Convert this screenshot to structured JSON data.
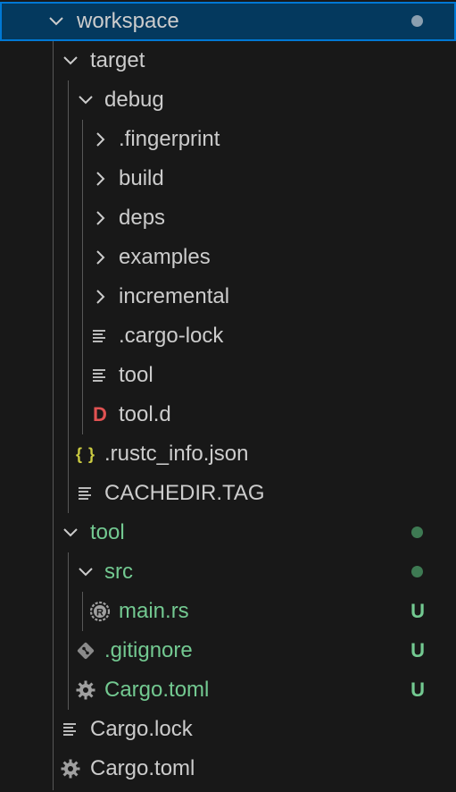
{
  "explorer": {
    "items": [
      {
        "label": "workspace",
        "kind": "folder-open",
        "depth": 0,
        "selected": true,
        "color": "default",
        "decoration": "dot-grey"
      },
      {
        "label": "target",
        "kind": "folder-open",
        "depth": 1,
        "color": "default"
      },
      {
        "label": "debug",
        "kind": "folder-open",
        "depth": 2,
        "color": "default"
      },
      {
        "label": ".fingerprint",
        "kind": "folder-closed",
        "depth": 3,
        "color": "default"
      },
      {
        "label": "build",
        "kind": "folder-closed",
        "depth": 3,
        "color": "default"
      },
      {
        "label": "deps",
        "kind": "folder-closed",
        "depth": 3,
        "color": "default"
      },
      {
        "label": "examples",
        "kind": "folder-closed",
        "depth": 3,
        "color": "default"
      },
      {
        "label": "incremental",
        "kind": "folder-closed",
        "depth": 3,
        "color": "default"
      },
      {
        "label": ".cargo-lock",
        "kind": "file-lines",
        "depth": 3,
        "color": "default"
      },
      {
        "label": "tool",
        "kind": "file-lines",
        "depth": 3,
        "color": "default"
      },
      {
        "label": "tool.d",
        "kind": "file-d",
        "depth": 3,
        "color": "default"
      },
      {
        "label": ".rustc_info.json",
        "kind": "file-json",
        "depth": 2,
        "color": "default"
      },
      {
        "label": "CACHEDIR.TAG",
        "kind": "file-lines",
        "depth": 2,
        "color": "default"
      },
      {
        "label": "tool",
        "kind": "folder-open",
        "depth": 1,
        "color": "green",
        "decoration": "dot-green"
      },
      {
        "label": "src",
        "kind": "folder-open",
        "depth": 2,
        "color": "green",
        "decoration": "dot-green"
      },
      {
        "label": "main.rs",
        "kind": "file-rust",
        "depth": 3,
        "color": "green",
        "decoration": "U"
      },
      {
        "label": ".gitignore",
        "kind": "file-git",
        "depth": 2,
        "color": "green",
        "decoration": "U"
      },
      {
        "label": "Cargo.toml",
        "kind": "file-gear",
        "depth": 2,
        "color": "green",
        "decoration": "U"
      },
      {
        "label": "Cargo.lock",
        "kind": "file-lines",
        "depth": 1,
        "color": "default"
      },
      {
        "label": "Cargo.toml",
        "kind": "file-gear",
        "depth": 1,
        "color": "default"
      }
    ]
  },
  "colors": {
    "background": "#181818",
    "selection": "#04395e",
    "selection_border": "#0078d4",
    "untracked_green": "#73c991",
    "text": "#cccccc"
  }
}
